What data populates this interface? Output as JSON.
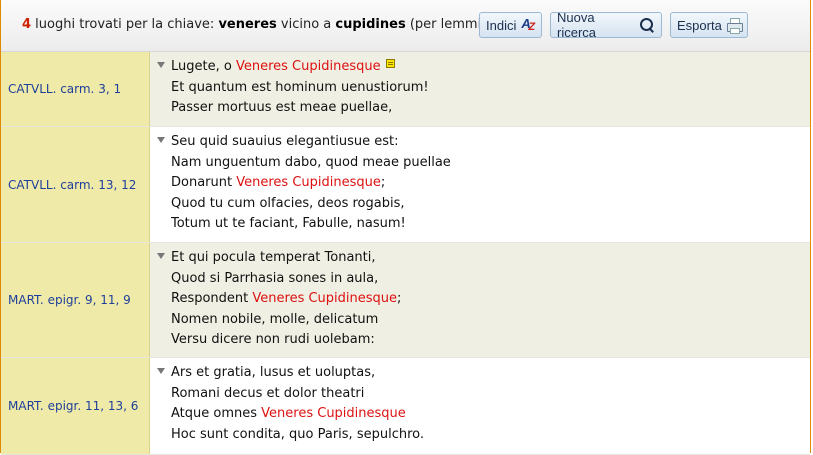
{
  "header": {
    "count": "4",
    "text_before_key": " luoghi trovati per la chiave: ",
    "key1": "veneres",
    "text_between": " vicino a ",
    "key2": "cupidines",
    "text_after": " (per lemmi)"
  },
  "toolbar": {
    "indici_label": "Indici",
    "nuova_ricerca_label": "Nuova ricerca",
    "esporta_label": "Esporta"
  },
  "results": [
    {
      "ref": "CATVLL. carm. 3, 1",
      "lines": [
        {
          "pre": "Lugete, o ",
          "hl": "Veneres Cupidinesque",
          "post": ""
        },
        {
          "pre": "Et quantum est hominum uenustiorum!",
          "hl": "",
          "post": ""
        },
        {
          "pre": "Passer mortuus est meae puellae,",
          "hl": "",
          "post": ""
        }
      ]
    },
    {
      "ref": "CATVLL. carm. 13, 12",
      "lines": [
        {
          "pre": "Seu quid suauius elegantiusue est:",
          "hl": "",
          "post": ""
        },
        {
          "pre": "Nam unguentum dabo, quod meae puellae",
          "hl": "",
          "post": ""
        },
        {
          "pre": "Donarunt ",
          "hl": "Veneres Cupidinesque",
          "post": ";"
        },
        {
          "pre": "Quod tu cum olfacies, deos rogabis,",
          "hl": "",
          "post": ""
        },
        {
          "pre": "Totum ut te faciant, Fabulle, nasum!",
          "hl": "",
          "post": ""
        }
      ]
    },
    {
      "ref": "MART. epigr. 9, 11, 9",
      "lines": [
        {
          "pre": "Et qui pocula temperat Tonanti,",
          "hl": "",
          "post": ""
        },
        {
          "pre": "Quod si Parrhasia sones in aula,",
          "hl": "",
          "post": ""
        },
        {
          "pre": "Respondent ",
          "hl": "Veneres Cupidinesque",
          "post": ";"
        },
        {
          "pre": "Nomen nobile, molle, delicatum",
          "hl": "",
          "post": ""
        },
        {
          "pre": "Versu dicere non rudi uolebam:",
          "hl": "",
          "post": ""
        }
      ]
    },
    {
      "ref": "MART. epigr. 11, 13, 6",
      "lines": [
        {
          "pre": "Ars et gratia, lusus et uoluptas,",
          "hl": "",
          "post": ""
        },
        {
          "pre": "Romani decus et dolor theatri",
          "hl": "",
          "post": ""
        },
        {
          "pre": "Atque omnes ",
          "hl": "Veneres Cupidinesque",
          "post": ""
        },
        {
          "pre": "Hoc sunt condita, quo Paris, sepulchro.",
          "hl": "",
          "post": ""
        }
      ]
    }
  ]
}
